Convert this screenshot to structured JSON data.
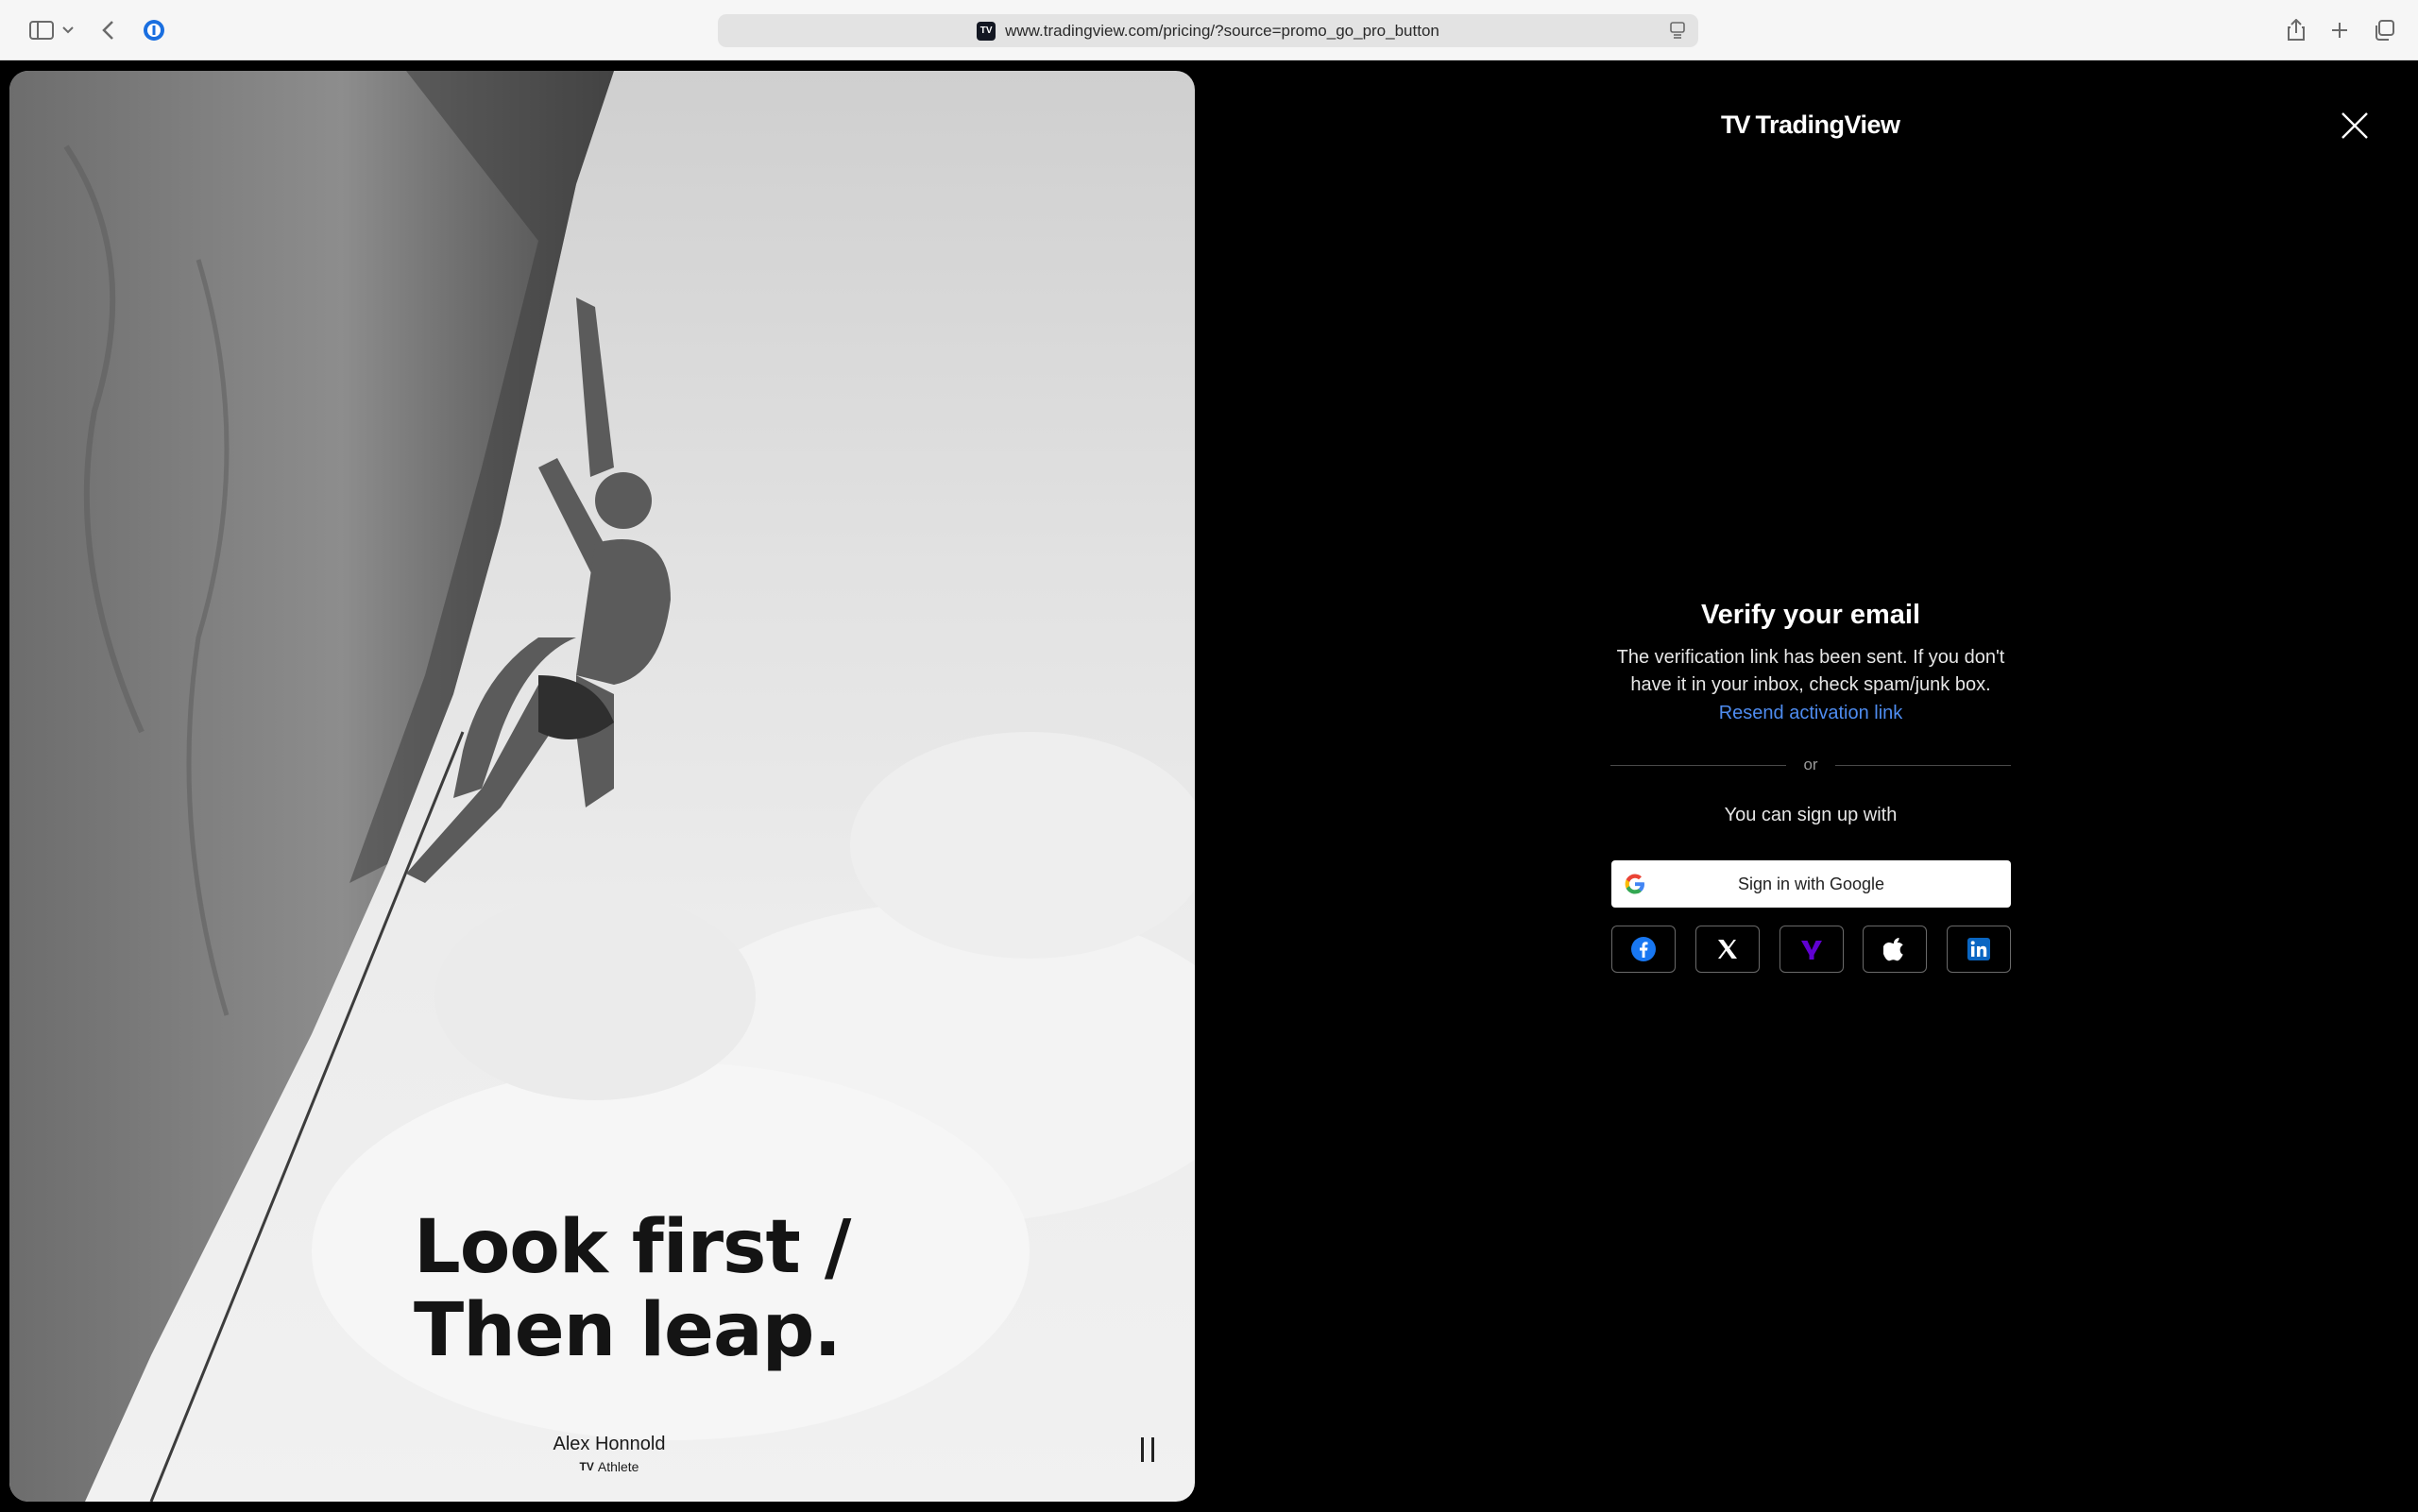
{
  "browser": {
    "url": "www.tradingview.com/pricing/?source=promo_go_pro_button",
    "favicon_text": "TV"
  },
  "hero": {
    "headline_line1": "Look first /",
    "headline_line2": "Then leap.",
    "athlete_name": "Alex Honnold",
    "athlete_role": "Athlete",
    "athlete_logo": "TV"
  },
  "brand": {
    "logo_mark": "TV",
    "logo_text": "TradingView"
  },
  "verify": {
    "title": "Verify your email",
    "message_line1": "The verification link has been sent. If you don't",
    "message_line2": "have it in your inbox, check spam/junk box.",
    "resend_link": "Resend activation link",
    "divider": "or",
    "signup_label": "You can sign up with",
    "google_button": "Sign in with Google"
  },
  "colors": {
    "link": "#4e8cf0",
    "facebook": "#1877f2",
    "yahoo": "#6001d2",
    "linkedin": "#0a66c2"
  }
}
